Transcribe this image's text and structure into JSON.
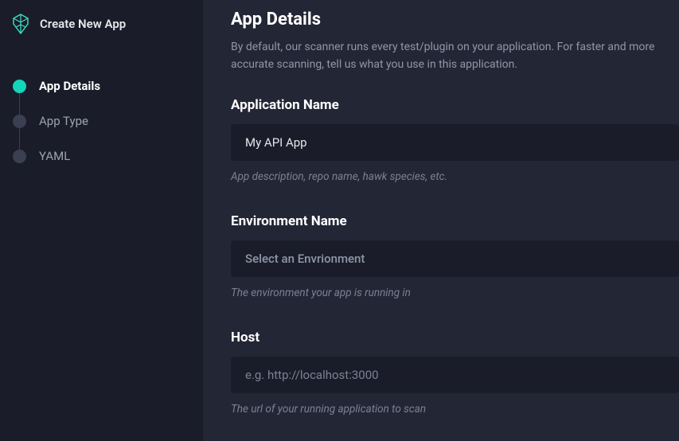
{
  "sidebar": {
    "title": "Create New App",
    "steps": [
      {
        "label": "App Details",
        "active": true
      },
      {
        "label": "App Type",
        "active": false
      },
      {
        "label": "YAML",
        "active": false
      }
    ]
  },
  "main": {
    "title": "App Details",
    "description": "By default, our scanner runs every test/plugin on your application. For faster and more accurate scanning, tell us what you use in this application.",
    "fields": {
      "appName": {
        "label": "Application Name",
        "value": "My API App",
        "hint": "App description, repo name, hawk species, etc."
      },
      "envName": {
        "label": "Environment Name",
        "placeholder": "Select an Envrionment",
        "hint": "The environment your app is running in"
      },
      "host": {
        "label": "Host",
        "placeholder": "e.g. http://localhost:3000",
        "hint": "The url of your running application to scan"
      }
    }
  }
}
